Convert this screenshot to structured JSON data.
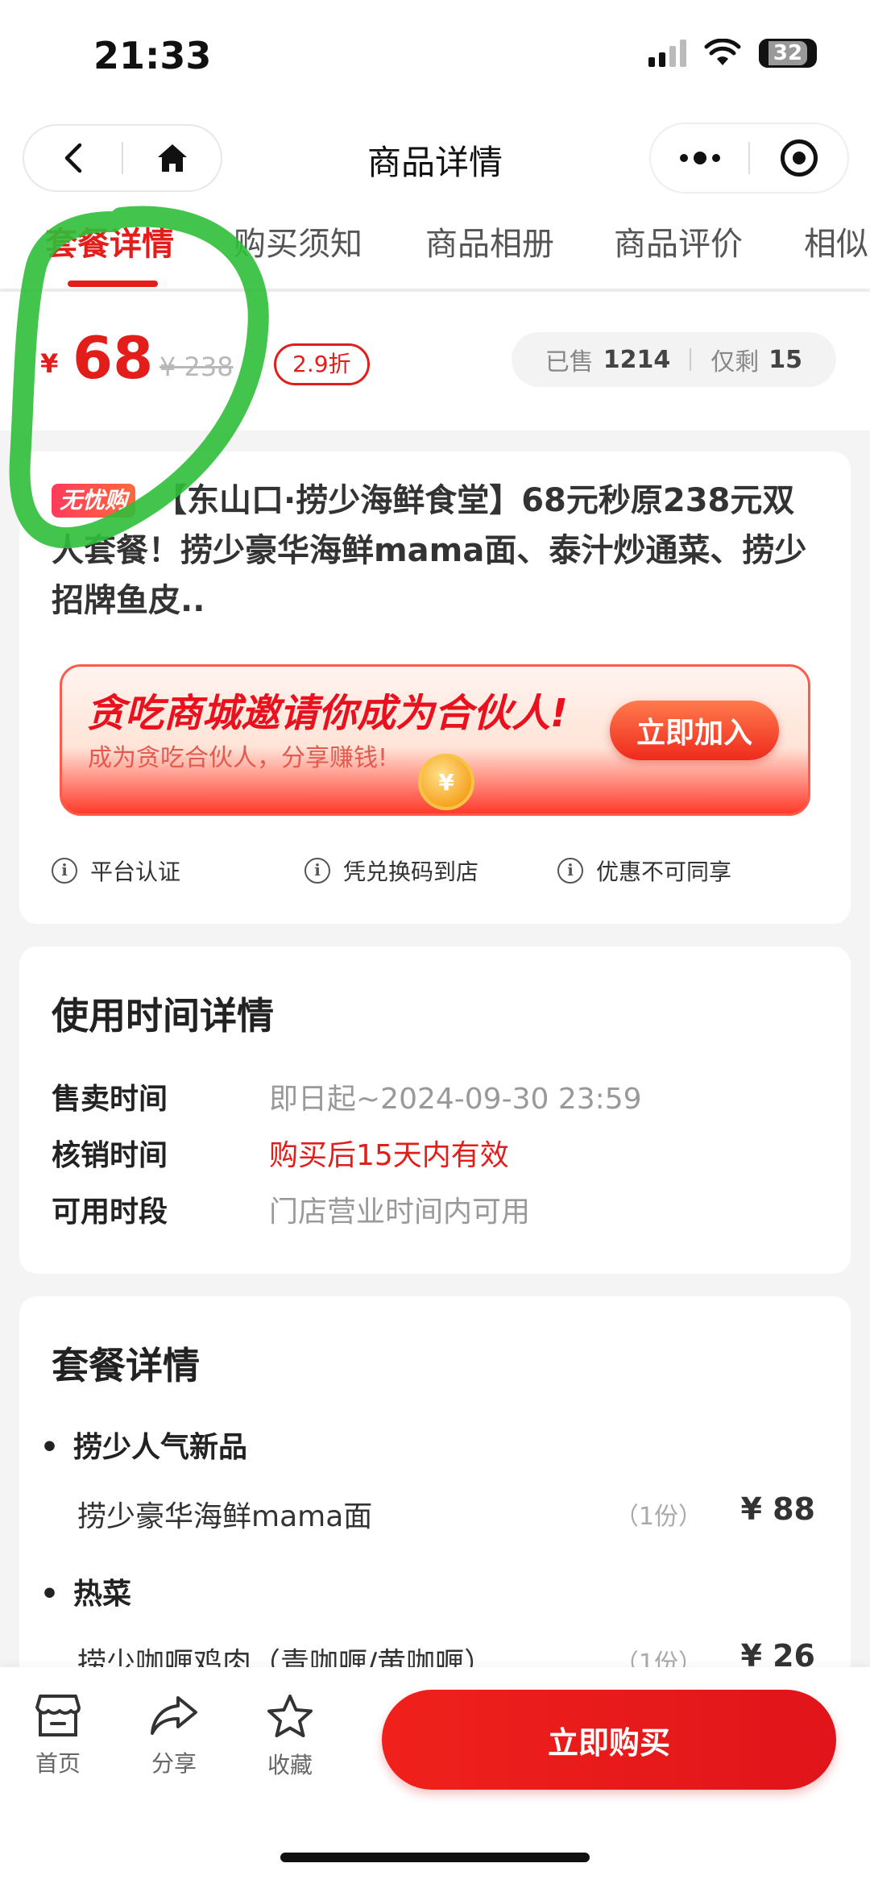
{
  "status_bar": {
    "time": "21:33",
    "battery": "32"
  },
  "nav": {
    "title": "商品详情"
  },
  "tabs": [
    {
      "label": "套餐详情"
    },
    {
      "label": "购买须知"
    },
    {
      "label": "商品相册"
    },
    {
      "label": "商品评价"
    },
    {
      "label": "相似"
    }
  ],
  "price": {
    "currency": "¥",
    "current": "68",
    "original": "¥ 238",
    "discount": "2.9折",
    "sold_label": "已售",
    "sold_count": "1214",
    "left_label": "仅剩",
    "left_count": "15"
  },
  "product": {
    "badge": "无忧购",
    "title": "【东山口·捞少海鲜食堂】68元秒原238元双人套餐！捞少豪华海鲜mama面、泰汁炒通菜、捞少招牌鱼皮.."
  },
  "banner": {
    "title": "贪吃商城邀请你成为合伙人!",
    "subtitle": "成为贪吃合伙人，分享赚钱!",
    "button": "立即加入"
  },
  "features": [
    {
      "label": "平台认证"
    },
    {
      "label": "凭兑换码到店"
    },
    {
      "label": "优惠不可同享"
    }
  ],
  "usage": {
    "title": "使用时间详情",
    "rows": [
      {
        "label": "售卖时间",
        "value": "即日起~2024-09-30 23:59"
      },
      {
        "label": "核销时间",
        "value": "购买后15天内有效"
      },
      {
        "label": "可用时段",
        "value": "门店营业时间内可用"
      }
    ]
  },
  "package": {
    "title": "套餐详情",
    "groups": [
      {
        "name": "捞少人气新品",
        "items": [
          {
            "name": "捞少豪华海鲜mama面",
            "qty": "（1份）",
            "price": "¥ 88"
          }
        ]
      },
      {
        "name": "热菜",
        "items": [
          {
            "name": "捞少咖喱鸡肉（青咖喱/黄咖喱）",
            "qty": "（1份）",
            "price": "¥ 26"
          }
        ]
      }
    ]
  },
  "bottom": {
    "home": "首页",
    "share": "分享",
    "favorite": "收藏",
    "buy": "立即购买"
  },
  "colors": {
    "accent": "#e31d1a",
    "annotation": "#2fbf3a"
  }
}
